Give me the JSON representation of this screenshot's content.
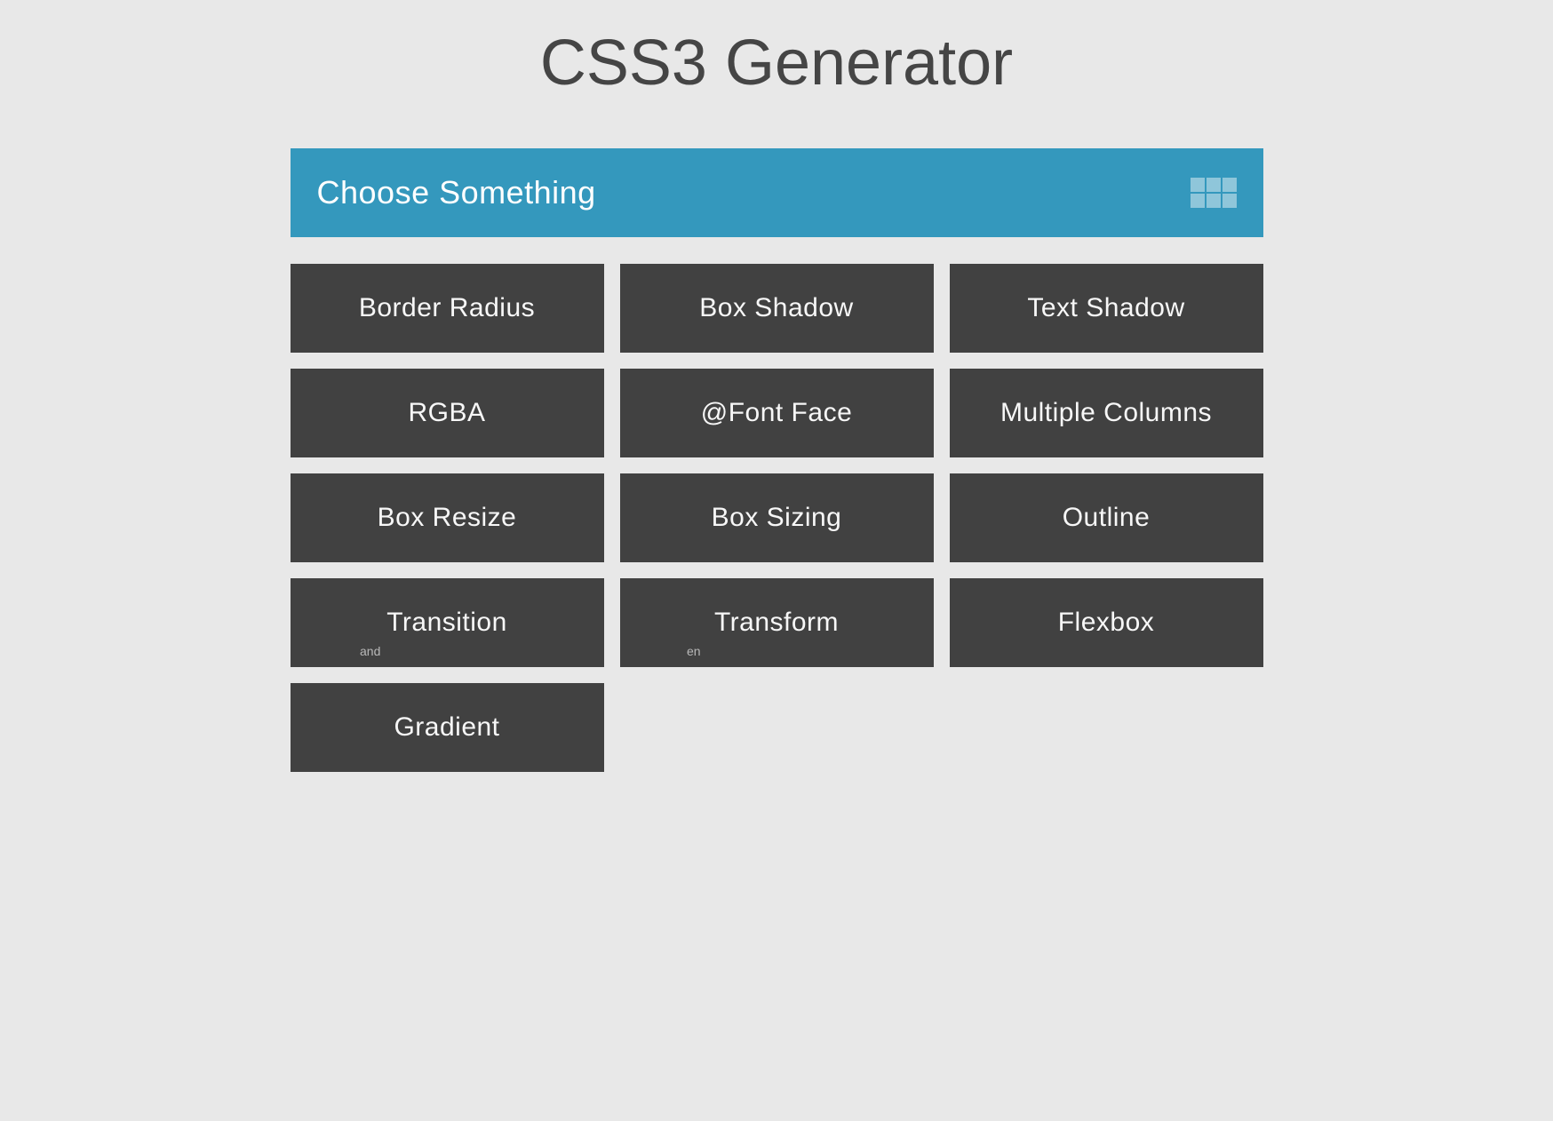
{
  "page": {
    "title": "CSS3 Generator"
  },
  "selector": {
    "label": "Choose Something"
  },
  "tiles": [
    {
      "label": "Border Radius"
    },
    {
      "label": "Box Shadow"
    },
    {
      "label": "Text Shadow"
    },
    {
      "label": "RGBA"
    },
    {
      "label": "@Font Face"
    },
    {
      "label": "Multiple Columns"
    },
    {
      "label": "Box Resize"
    },
    {
      "label": "Box Sizing"
    },
    {
      "label": "Outline"
    },
    {
      "label": "Transition"
    },
    {
      "label": "Transform"
    },
    {
      "label": "Flexbox"
    },
    {
      "label": "Gradient"
    }
  ],
  "watermark": {
    "wm1": "and",
    "wm2": "en"
  },
  "colors": {
    "accent": "#3498bd",
    "tile_bg": "#414141",
    "page_bg": "#e8e8e8",
    "title_fg": "#454545"
  }
}
